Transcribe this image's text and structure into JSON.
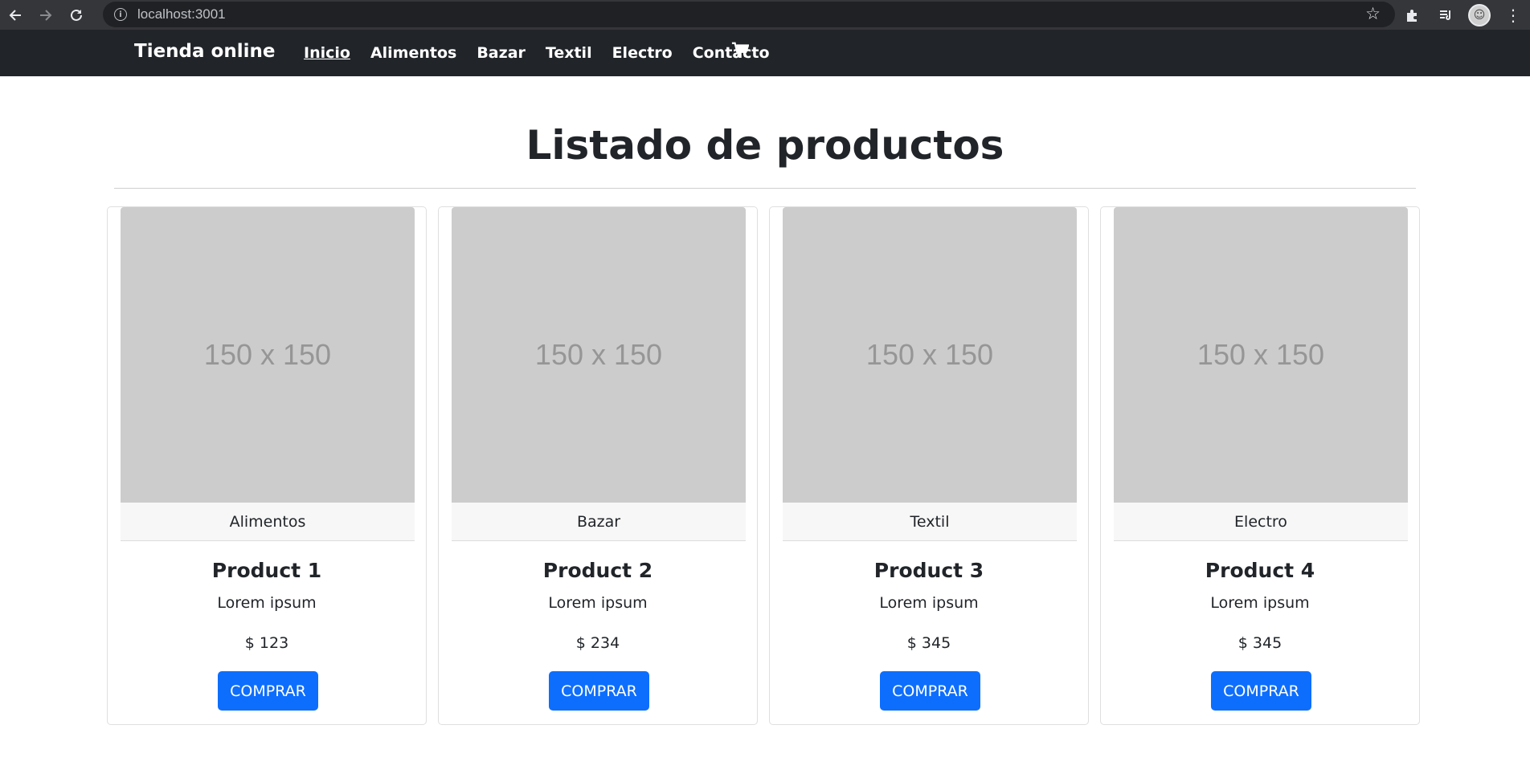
{
  "browser": {
    "url": "localhost:3001",
    "back_icon": "arrow-left-icon",
    "forward_icon": "arrow-right-icon",
    "reload_icon": "reload-icon"
  },
  "navbar": {
    "brand": "Tienda online",
    "links": [
      {
        "label": "Inicio",
        "active": true
      },
      {
        "label": "Alimentos"
      },
      {
        "label": "Bazar"
      },
      {
        "label": "Textil"
      },
      {
        "label": "Electro"
      },
      {
        "label": "Contacto"
      }
    ],
    "cart_icon": "shopping-cart-icon",
    "background": "#212529"
  },
  "main": {
    "title": "Listado de productos"
  },
  "products": [
    {
      "image_text": "150 x 150",
      "category": "Alimentos",
      "name": "Product 1",
      "description": "Lorem ipsum",
      "price": "$ 123",
      "button": "COMPRAR"
    },
    {
      "image_text": "150 x 150",
      "category": "Bazar",
      "name": "Product 2",
      "description": "Lorem ipsum",
      "price": "$ 234",
      "button": "COMPRAR"
    },
    {
      "image_text": "150 x 150",
      "category": "Textil",
      "name": "Product 3",
      "description": "Lorem ipsum",
      "price": "$ 345",
      "button": "COMPRAR"
    },
    {
      "image_text": "150 x 150",
      "category": "Electro",
      "name": "Product 4",
      "description": "Lorem ipsum",
      "price": "$ 345",
      "button": "COMPRAR"
    }
  ],
  "colors": {
    "primary": "#0d6efd",
    "placeholder": "#cccccc"
  }
}
